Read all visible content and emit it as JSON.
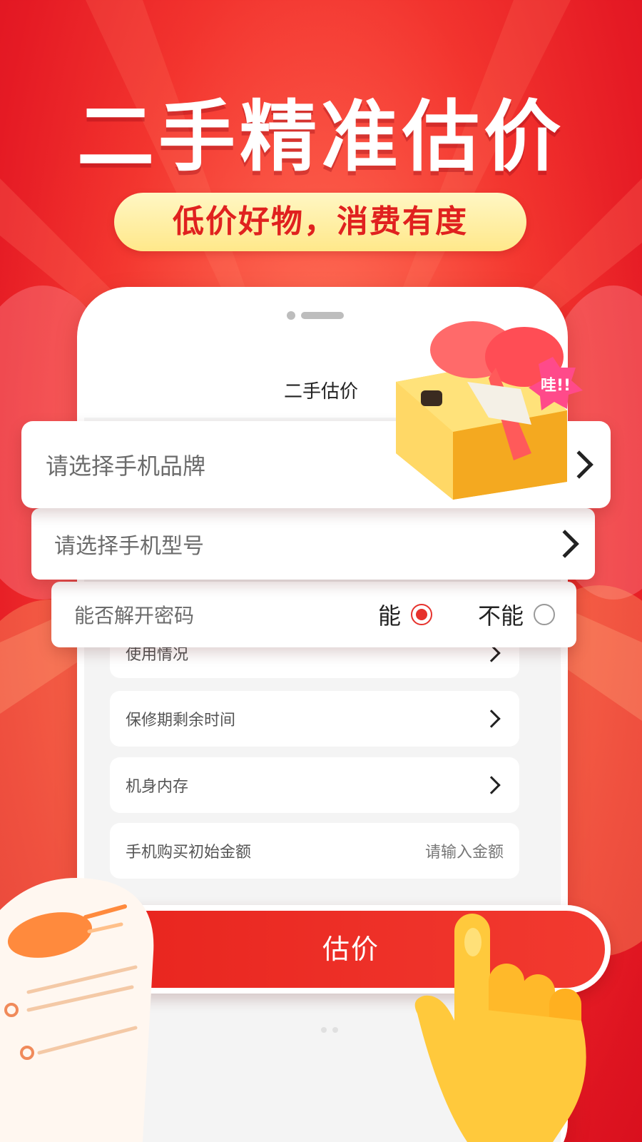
{
  "colors": {
    "background": "#e8231f",
    "accent": "#e6322d",
    "pill": "#ffe88a",
    "button": "#ee2c26"
  },
  "header": {
    "headline": "二手精准估价",
    "tagline": "低价好物，消费有度"
  },
  "phone": {
    "title": "二手估价"
  },
  "selects": {
    "brand_label": "请选择手机品牌",
    "model_label": "请选择手机型号"
  },
  "unlock": {
    "label": "能否解开密码",
    "options": [
      "能",
      "不能"
    ],
    "selected": "能"
  },
  "form": {
    "rows": [
      {
        "label": "使用情况"
      },
      {
        "label": "保修期剩余时间"
      },
      {
        "label": "机身内存"
      },
      {
        "label": "手机购买初始金额",
        "placeholder": "请输入金额"
      }
    ]
  },
  "actions": {
    "estimate_label": "估价"
  },
  "decor": {
    "gift_bubble": "哇!!",
    "icons": [
      "gift-box-icon",
      "pointing-hand-icon",
      "receipt-icon"
    ]
  }
}
